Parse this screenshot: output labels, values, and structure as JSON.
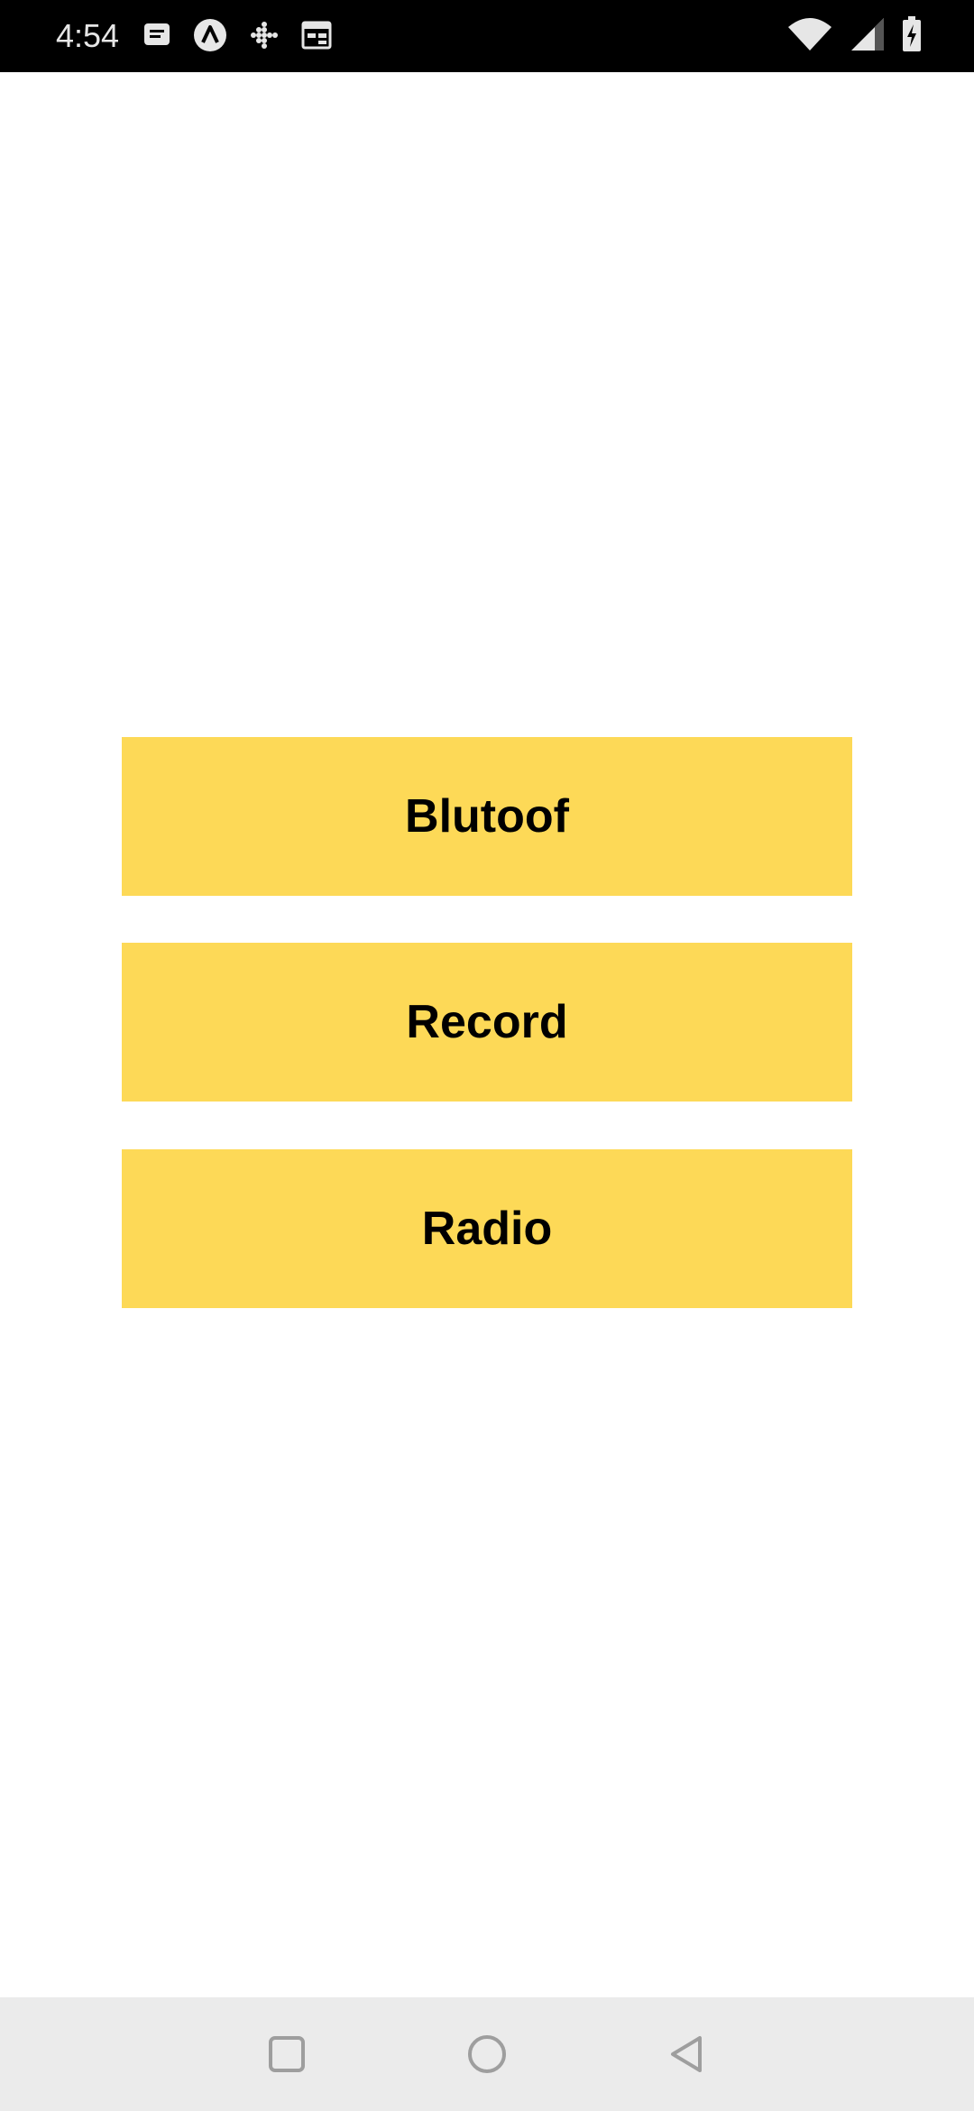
{
  "status_bar": {
    "time": "4:54",
    "left_icons": [
      "message-icon",
      "app-a-icon",
      "dots-grid-icon",
      "calendar-icon"
    ],
    "right_icons": [
      "wifi-icon",
      "cell-signal-icon",
      "battery-charging-icon"
    ]
  },
  "menu": {
    "buttons": [
      {
        "label": "Blutoof"
      },
      {
        "label": "Record"
      },
      {
        "label": "Radio"
      }
    ]
  },
  "nav_bar": {
    "icons": [
      "recents-icon",
      "home-icon",
      "back-icon"
    ]
  },
  "colors": {
    "button_bg": "#fdd957",
    "button_text": "#000000",
    "status_bar_bg": "#000000",
    "nav_bar_bg": "#ebebeb",
    "nav_icon": "#9e9e9e"
  }
}
